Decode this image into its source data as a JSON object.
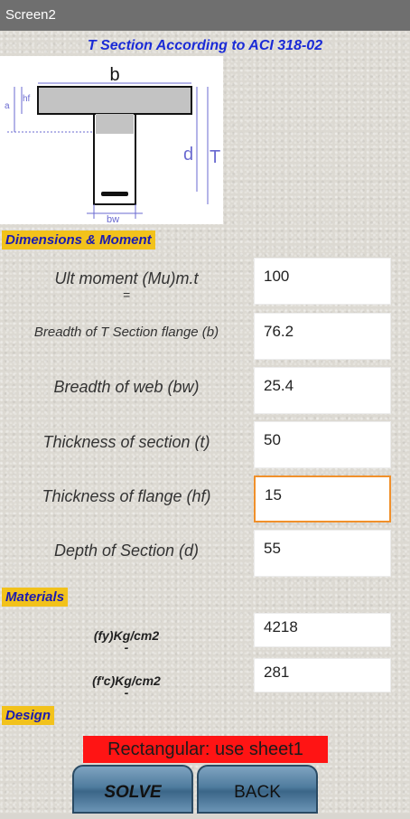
{
  "window": {
    "title": "Screen2"
  },
  "heading": "T Section According to ACI 318-02",
  "diagram": {
    "labels": {
      "b": "b",
      "a": "a",
      "hf": "hf",
      "d": "d",
      "T": "T",
      "bw": "bw"
    }
  },
  "sections": {
    "dimensions": "Dimensions & Moment",
    "materials": "Materials",
    "design": "Design"
  },
  "fields": [
    {
      "label": "Ult moment (Mu)m.t",
      "sub": "=",
      "value": "100"
    },
    {
      "label": "Breadth of T Section flange (b)",
      "value": "76.2"
    },
    {
      "label": "Breadth of web (bw)",
      "value": "25.4"
    },
    {
      "label": "Thickness of section (t)",
      "value": "50"
    },
    {
      "label": "Thickness of  flange (hf)",
      "value": "15"
    },
    {
      "label": "Depth  of Section (d)",
      "value": "55"
    }
  ],
  "materials": [
    {
      "label": "(fy)Kg/cm2",
      "sub": "-",
      "value": "4218"
    },
    {
      "label": "(f'c)Kg/cm2",
      "sub": "-",
      "value": "281"
    }
  ],
  "result": "Rectangular: use sheet1",
  "buttons": {
    "solve": "SOLVE",
    "back": "BACK"
  },
  "colors": {
    "heading": "#1a2bd6",
    "section_bg": "#f2c21b",
    "result_bg": "#ff1414",
    "focus": "#f0902b"
  }
}
